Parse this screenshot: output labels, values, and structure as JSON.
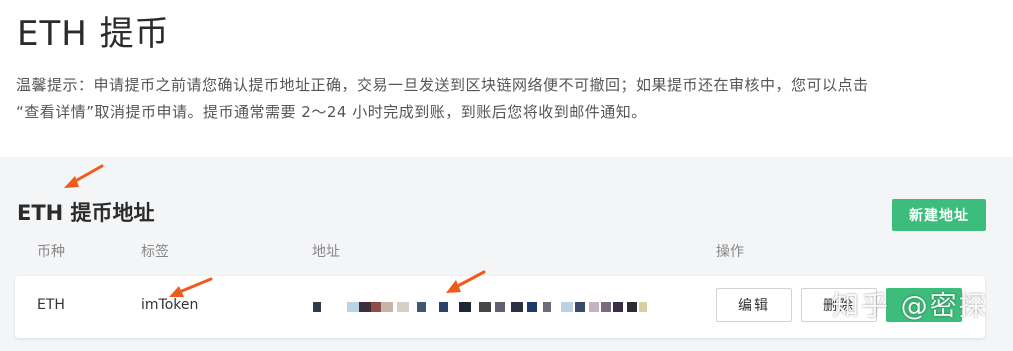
{
  "page_title": "ETH 提币",
  "notice": {
    "line1": "温馨提示：申请提币之前请您确认提币地址正确，交易一旦发送到区块链网络便不可撤回；如果提币还在审核中，您可以点击",
    "line2": "“查看详情”取消提币申请。提币通常需要 2～24 小时完成到账，到账后您将收到邮件通知。"
  },
  "section": {
    "title": "ETH 提币地址",
    "add_button": "新建地址"
  },
  "table": {
    "headers": [
      "币种",
      "标签",
      "地址",
      "操作"
    ],
    "rows": [
      {
        "currency": "ETH",
        "label": "imToken",
        "address": "",
        "edit_button": "编辑",
        "delete_button": "删除"
      }
    ]
  },
  "watermark": "知乎 @密探",
  "colors": {
    "accent_green": "#3cbd7c",
    "annotation_arrow": "#f05a1a",
    "panel_bg": "#f4f5f7"
  }
}
